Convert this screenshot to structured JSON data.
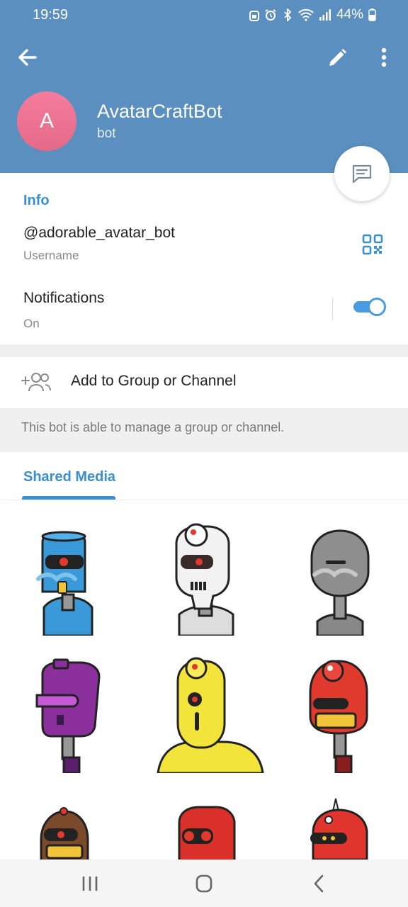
{
  "status": {
    "time": "19:59",
    "battery": "44%",
    "icons": [
      "alarm-lock-icon",
      "alarm-icon",
      "bluetooth-icon",
      "wifi-icon",
      "signal-icon",
      "battery-icon"
    ]
  },
  "header": {
    "back_icon": "arrow-left-icon",
    "edit_icon": "pencil-icon",
    "more_icon": "more-vertical-icon",
    "bg_color": "#5b8fc0"
  },
  "profile": {
    "avatar_letter": "A",
    "name": "AvatarCraftBot",
    "subtitle": "bot"
  },
  "info": {
    "title": "Info",
    "username": "@adorable_avatar_bot",
    "username_label": "Username",
    "notifications_label": "Notifications",
    "notifications_value": "On",
    "notifications_enabled": true
  },
  "actions": {
    "add_to_group": "Add to Group or Channel"
  },
  "hint": {
    "text": "This bot is able to manage a group or channel."
  },
  "media": {
    "tab_label": "Shared Media",
    "items": [
      {
        "name": "blue-robot-sticker",
        "color": "#3a9ad9"
      },
      {
        "name": "white-robot-sticker",
        "color": "#f2f2f2"
      },
      {
        "name": "gray-robot-sticker",
        "color": "#8e8e8e"
      },
      {
        "name": "purple-robot-sticker",
        "color": "#8a2f9c"
      },
      {
        "name": "yellow-robot-sticker",
        "color": "#f2e43a"
      },
      {
        "name": "red-robot-sticker",
        "color": "#e03a2f"
      },
      {
        "name": "brown-robot-sticker",
        "color": "#7a4a2a"
      },
      {
        "name": "red-robot-sticker-2",
        "color": "#d9302a"
      },
      {
        "name": "red-robot-sticker-3",
        "color": "#e0352d"
      }
    ]
  },
  "nav": {
    "recents_icon": "recents-icon",
    "home_icon": "home-icon",
    "back_icon": "nav-back-icon"
  },
  "colors": {
    "accent": "#3a8fd0",
    "toggle": "#4a9be0"
  }
}
